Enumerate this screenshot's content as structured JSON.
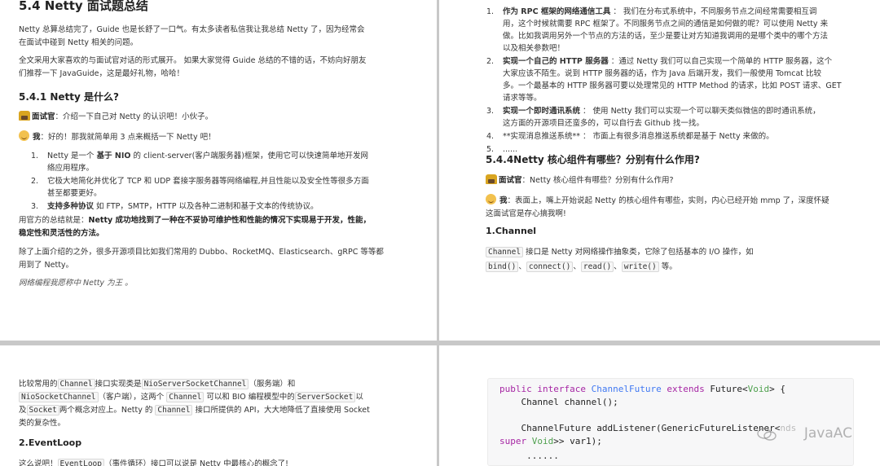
{
  "page1": {
    "title": "5.4 Netty 面试题总结",
    "intro1_line1": "Netty 总算总结完了，Guide 也是长舒了一口气。有太多读者私信我让我总结 Netty 了，因为经常会",
    "intro1_line2": "在面试中碰到 Netty 相关的问题。",
    "intro2_line1": "全文采用大家喜欢的与面试官对话的形式展开。 如果大家觉得 Guide 总结的不错的话，不妨向好朋友",
    "intro2_line2": "们推荐一下 JavaGuide，这是最好礼物，哈哈！",
    "section_title": "5.4.1 Netty 是什么?",
    "interviewer_label": "面试官",
    "interviewer_text": "：介绍一下自己对 Netty 的认识吧！小伙子。",
    "me_label": "我",
    "me_text": "：好的！那我就简单用 3 点来概括一下 Netty 吧！",
    "items": [
      {
        "num": "1.",
        "pre": "Netty 是一个 ",
        "bold": "基于 NIO",
        "post": " 的 client-server(客户端服务器)框架，使用它可以快速简单地开发网",
        "line2": "络应用程序。"
      },
      {
        "num": "2.",
        "pre": "它极大地简化并优化了 TCP 和 UDP 套接字服务器等网络编程,并且性能以及安全性等很多方面",
        "bold": "",
        "post": "",
        "line2": "甚至都要更好。"
      },
      {
        "num": "3.",
        "pre": "",
        "bold": "支持多种协议",
        "post": " 如 FTP，SMTP，HTTP 以及各种二进制和基于文本的传统协议。",
        "line2": ""
      }
    ],
    "summary_pre": "用官方的总结就是：",
    "summary_bold1": "Netty 成功地找到了一种在不妥协可维护性和性能的情况下实现易于开发，性能，",
    "summary_bold2": "稳定性和灵活性的方法。",
    "projects_line1": "除了上面介绍的之外，很多开源项目比如我们常用的 Dubbo、RocketMQ、Elasticsearch、gRPC 等等都",
    "projects_line2": "用到了 Netty。",
    "italic_note": "网络编程我愿称中 Netty 为王 。"
  },
  "page2": {
    "items": [
      {
        "num": "1.",
        "bold": "作为 RPC 框架的网络通信工具",
        "l1": " ： 我们在分布式系统中，不同服务节点之间经常需要相互调",
        "l2": "用，这个时候就需要 RPC 框架了。不同服务节点之间的通信是如何做的呢？可以使用 Netty 来",
        "l3": "做。比如我调用另外一个节点的方法的话，至少是要让对方知道我调用的是哪个类中的哪个方法",
        "l4": "以及相关参数吧！"
      },
      {
        "num": "2.",
        "bold": "实现一个自己的 HTTP 服务器",
        "l1": " ：通过 Netty 我们可以自己实现一个简单的 HTTP 服务器，这个",
        "l2": "大家应该不陌生。说到 HTTP 服务器的话，作为 Java 后端开发，我们一般使用 Tomcat 比较",
        "l3": "多。一个最基本的 HTTP 服务器可要以处理常见的 HTTP Method 的请求，比如 POST 请求、GET",
        "l4": "请求等等。"
      },
      {
        "num": "3.",
        "bold": "实现一个即时通讯系统",
        "l1": " ： 使用 Netty 我们可以实现一个可以聊天类似微信的即时通讯系统，",
        "l2": "这方面的开源项目还蛮多的，可以自行去 Github 找一找。",
        "l3": "",
        "l4": ""
      },
      {
        "num": "4.",
        "bold": "",
        "l1": "**实现消息推送系统** ： 市面上有很多消息推送系统都是基于 Netty 来做的。",
        "l2": "",
        "l3": "",
        "l4": ""
      },
      {
        "num": "5.",
        "bold": "",
        "l1": "......",
        "l2": "",
        "l3": "",
        "l4": ""
      }
    ],
    "section_title": "5.4.4Netty 核心组件有哪些？分别有什么作用?",
    "interviewer_label": "面试官",
    "interviewer_text": "：Netty 核心组件有哪些？分别有什么作用?",
    "me_label": "我",
    "me_text_line1": "：表面上，嘴上开始说起 Netty 的核心组件有哪些，实则，内心已经开始 mmp 了，深度怀疑",
    "me_text_line2": "这面试官是存心搞我啊!",
    "sub_title": "1.Channel",
    "channel_code": "Channel",
    "channel_desc": " 接口是 Netty 对网络操作抽象类，它除了包括基本的 I/O 操作，如",
    "methods": [
      "bind()",
      "connect()",
      "read()",
      "write()"
    ],
    "methods_sep": "、",
    "methods_tail": " 等。"
  },
  "page3": {
    "l1_a": "比较常用的",
    "l1_code1": "Channel",
    "l1_b": "接口实现类是",
    "l1_code2": "NioServerSocketChannel",
    "l1_c": "（服务端）和",
    "l2_code1": "NioSocketChannel",
    "l2_a": "（客户端），这两个 ",
    "l2_code2": "Channel",
    "l2_b": " 可以和 BIO 编程模型中的",
    "l2_code3": "ServerSocket",
    "l2_c": "以",
    "l3_a": "及",
    "l3_code1": "Socket",
    "l3_b": "两个概念对应上。Netty 的 ",
    "l3_code2": "Channel",
    "l3_c": " 接口所提供的 API，大大地降低了直接使用 Socket",
    "l4": "类的复杂性。",
    "sub_title": "2.EventLoop",
    "l5_a": "这么说吧！",
    "l5_code": "EventLoop",
    "l5_b": "（事件循环）接口可以说是 Netty 中最核心的概念了!"
  },
  "page4": {
    "code": {
      "line1": {
        "kw1": "public",
        "kw2": "interface",
        "ty": "ChannelFuture",
        "kw3": "extends",
        "rest1": "Future<",
        "gn": "Void",
        "rest2": "> {"
      },
      "line2": "    Channel channel();",
      "line3": "    ChannelFuture addListener(GenericFutureListener<",
      "line3_tail": "nds",
      "line4_kw": "super",
      "line4_gn": "Void",
      "line4_rest": ">> var1);",
      "line5": "     ......"
    },
    "watermark": "JavaAC"
  },
  "colors": {
    "background": "#c8c8c8",
    "page": "#ffffff",
    "keyword": "#a626a4",
    "type": "#4078f2",
    "generic": "#50a14f",
    "code_bg": "#f7f7f8"
  }
}
